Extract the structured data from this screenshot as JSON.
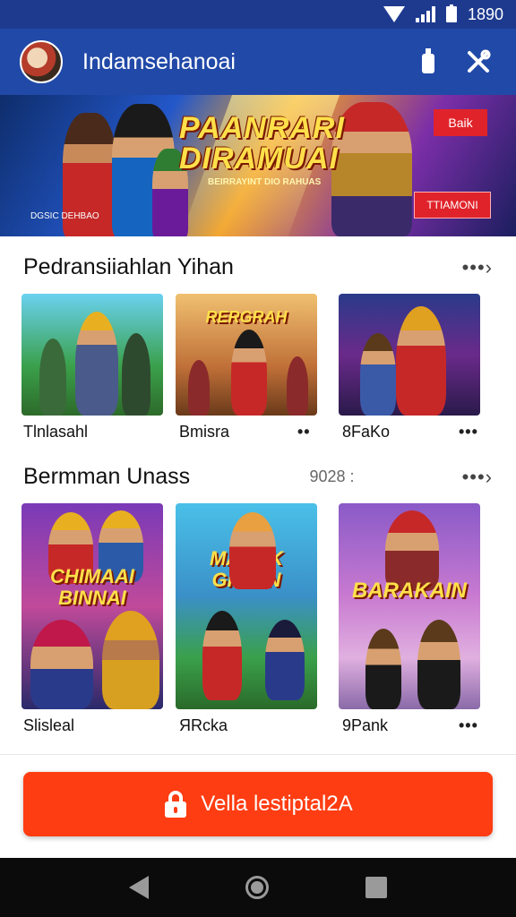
{
  "status": {
    "time": "1890"
  },
  "app_bar": {
    "title": "Indamsehanoai"
  },
  "banner": {
    "title_line1": "PAANRARI",
    "title_line2": "DIRAMUAI",
    "subtitle": "BEIRRAYINT DIO RAHUAS",
    "corner_tag": "Baik",
    "button_label": "TTIAMONI",
    "caption": "DGSIC DEHBAO"
  },
  "sections": [
    {
      "title": "Pedransiiahlan Yihan",
      "meta": "",
      "more": "•••›",
      "cards": [
        {
          "label": "Tlnlasahl",
          "art_text": "",
          "dots": ""
        },
        {
          "label": "Bmisra",
          "art_text": "RERGRAH",
          "dots": "••"
        },
        {
          "label": "8FaKo",
          "art_text": "",
          "dots": "•••"
        }
      ]
    },
    {
      "title": "Bermman Unass",
      "meta": "9028 :",
      "more": "•••›",
      "cards": [
        {
          "label": "Slisleal",
          "art_text": "CHIMAAI BINNAI",
          "dots": ""
        },
        {
          "label": "ЯRcka",
          "art_text": "MAKAK GINAIN",
          "dots": ""
        },
        {
          "label": "9Pank",
          "art_text": "BARAKAIN",
          "dots": "•••"
        }
      ]
    }
  ],
  "cta": {
    "label": "Vella lestiptal2A"
  },
  "colors": {
    "app_bar": "#2149a8",
    "status_bar": "#1e3a8f",
    "cta": "#ff3d12",
    "nav": "#0b0b0b"
  }
}
